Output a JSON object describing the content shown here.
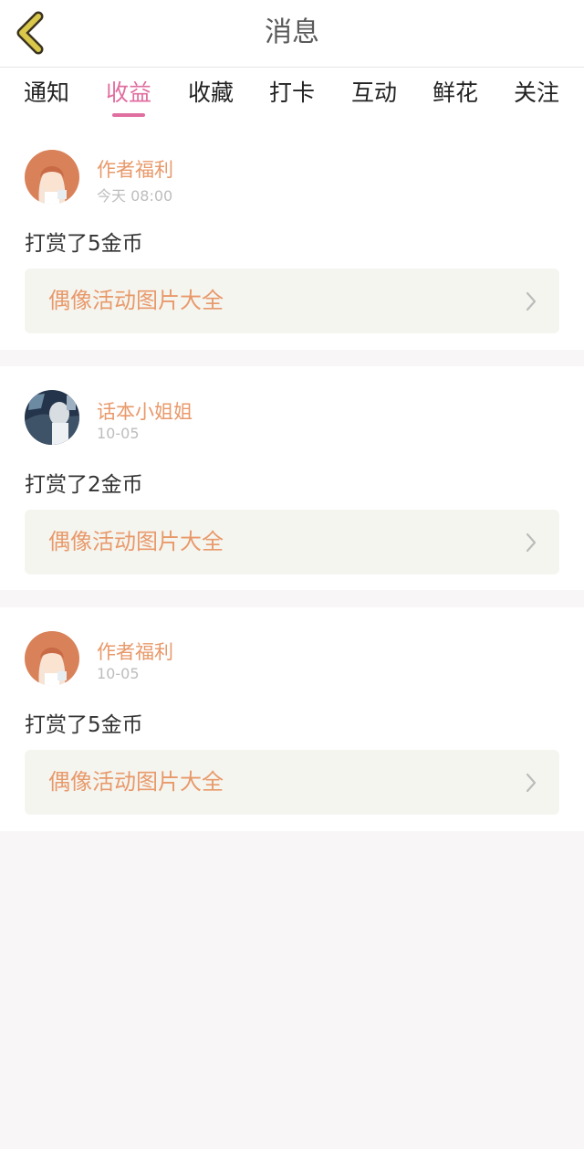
{
  "header": {
    "title": "消息",
    "back_icon": "chevron-left-icon"
  },
  "tabs": [
    {
      "label": "通知",
      "active": false
    },
    {
      "label": "收益",
      "active": true
    },
    {
      "label": "收藏",
      "active": false
    },
    {
      "label": "打卡",
      "active": false
    },
    {
      "label": "互动",
      "active": false
    },
    {
      "label": "鲜花",
      "active": false
    },
    {
      "label": "关注",
      "active": false
    }
  ],
  "messages": [
    {
      "author": "作者福利",
      "date": "今天 08:00",
      "text": "打赏了5金币",
      "link": "偶像活动图片大全"
    },
    {
      "author": "话本小姐姐",
      "date": "10-05",
      "text": "打赏了2金币",
      "link": "偶像活动图片大全"
    },
    {
      "author": "作者福利",
      "date": "10-05",
      "text": "打赏了5金币",
      "link": "偶像活动图片大全"
    }
  ],
  "colors": {
    "accent": "#e06ea0",
    "author": "#e8996a",
    "back_icon": "#d9c84a",
    "background": "#f8f6f6"
  }
}
